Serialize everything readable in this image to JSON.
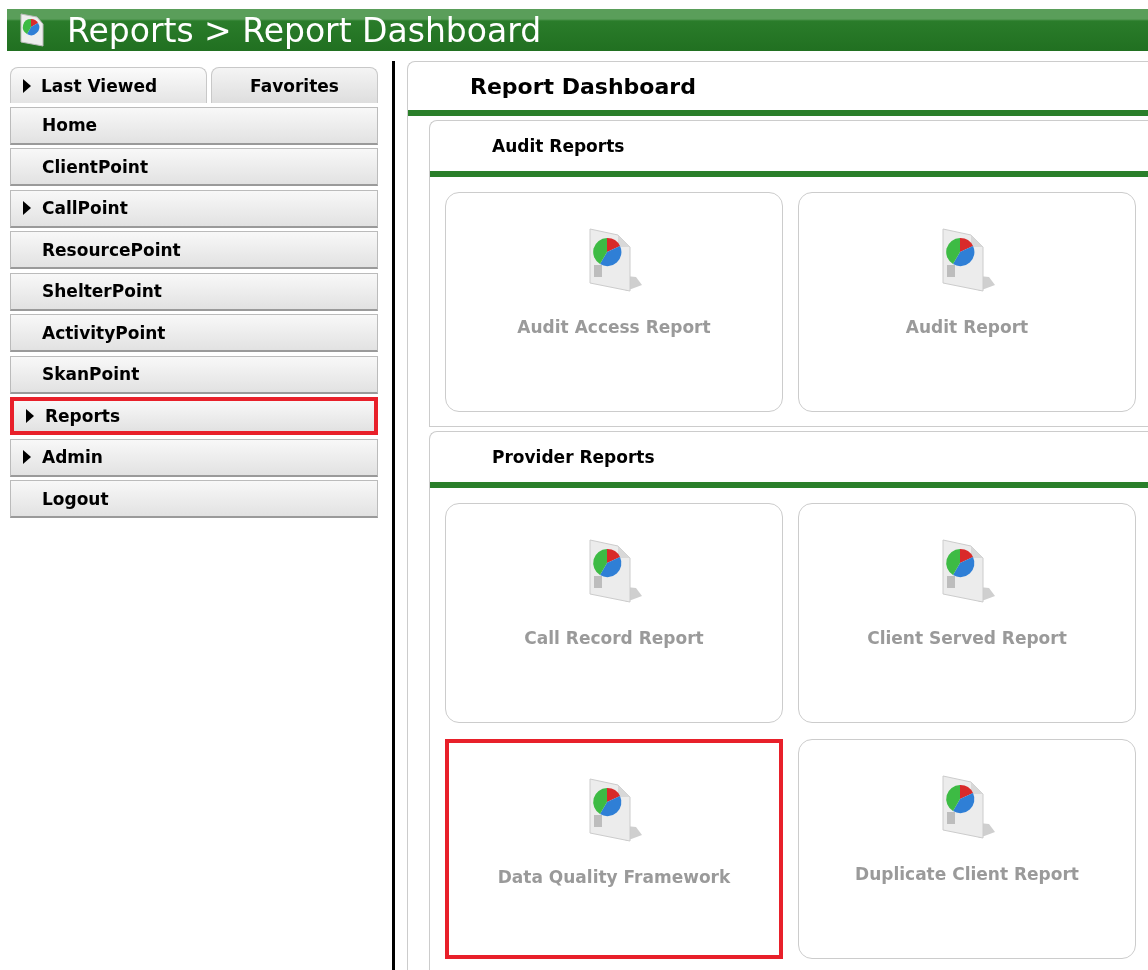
{
  "header": {
    "title": "Reports > Report Dashboard"
  },
  "sidebar": {
    "tabs": [
      {
        "label": "Last Viewed",
        "selected": true,
        "has_arrow": true
      },
      {
        "label": "Favorites",
        "selected": false,
        "has_arrow": false
      }
    ],
    "items": [
      {
        "label": "Home",
        "has_arrow": false,
        "highlighted": false
      },
      {
        "label": "ClientPoint",
        "has_arrow": false,
        "highlighted": false
      },
      {
        "label": "CallPoint",
        "has_arrow": true,
        "highlighted": false
      },
      {
        "label": "ResourcePoint",
        "has_arrow": false,
        "highlighted": false
      },
      {
        "label": "ShelterPoint",
        "has_arrow": false,
        "highlighted": false
      },
      {
        "label": "ActivityPoint",
        "has_arrow": false,
        "highlighted": false
      },
      {
        "label": "SkanPoint",
        "has_arrow": false,
        "highlighted": false
      },
      {
        "label": "Reports",
        "has_arrow": true,
        "highlighted": true
      },
      {
        "label": "Admin",
        "has_arrow": true,
        "highlighted": false
      },
      {
        "label": "Logout",
        "has_arrow": false,
        "highlighted": false
      }
    ]
  },
  "main": {
    "title": "Report Dashboard",
    "sections": [
      {
        "title": "Audit Reports",
        "reports": [
          {
            "label": "Audit Access Report",
            "highlighted": false
          },
          {
            "label": "Audit Report",
            "highlighted": false
          }
        ]
      },
      {
        "title": "Provider Reports",
        "reports": [
          {
            "label": "Call Record Report",
            "highlighted": false
          },
          {
            "label": "Client Served Report",
            "highlighted": false
          },
          {
            "label": "Data Quality Framework",
            "highlighted": true
          },
          {
            "label": "Duplicate Client Report",
            "highlighted": false
          }
        ]
      }
    ]
  }
}
